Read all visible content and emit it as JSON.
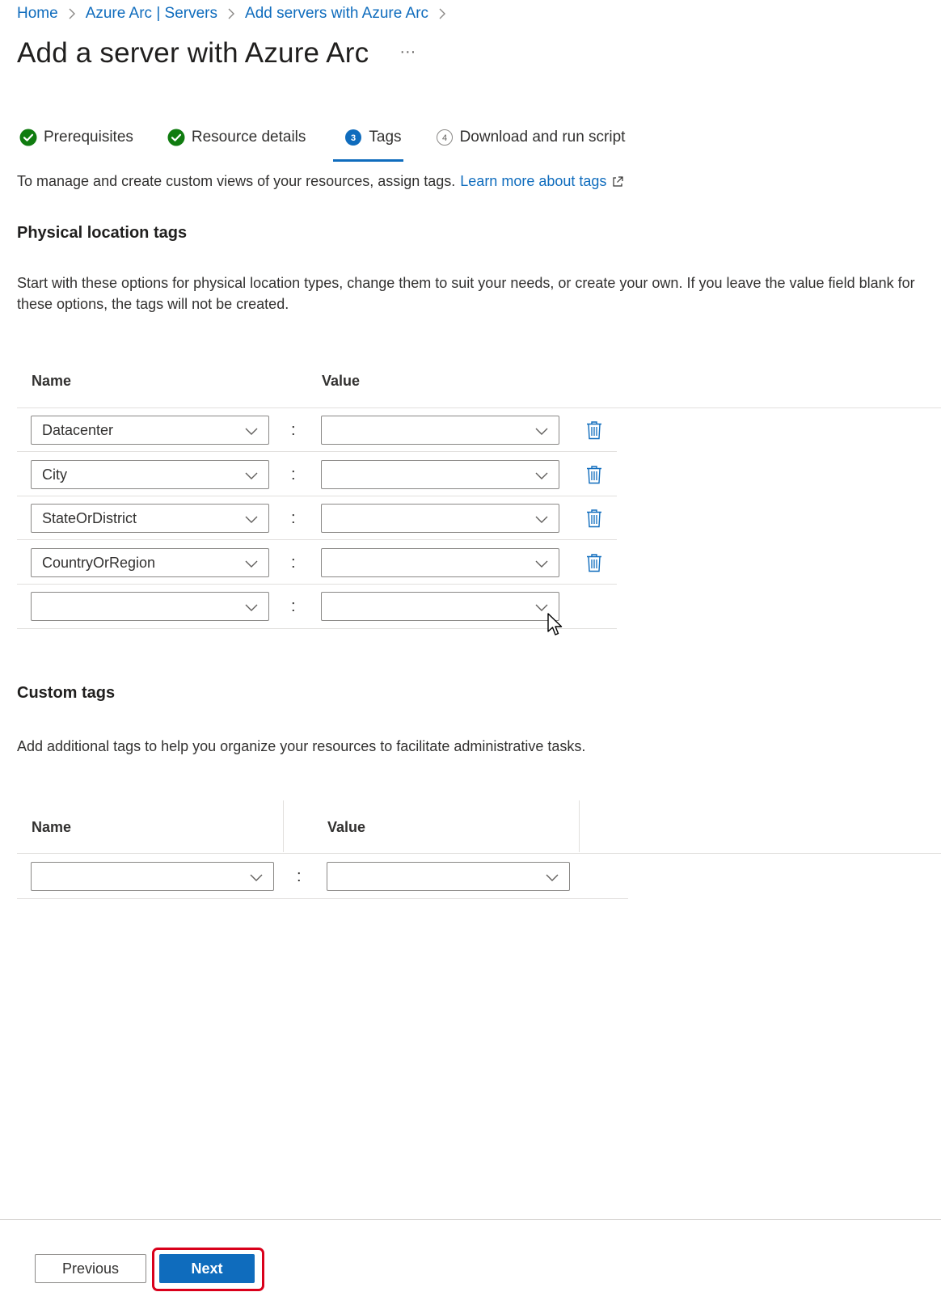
{
  "breadcrumb": [
    "Home",
    "Azure Arc | Servers",
    "Add servers with Azure Arc"
  ],
  "page_title": "Add a server with Azure Arc",
  "more_menu": "···",
  "steps": [
    {
      "label": "Prerequisites",
      "state": "complete"
    },
    {
      "label": "Resource details",
      "state": "complete"
    },
    {
      "label": "Tags",
      "state": "active",
      "number": "3"
    },
    {
      "label": "Download and run script",
      "state": "pending",
      "number": "4"
    }
  ],
  "intro": {
    "text": "To manage and create custom views of your resources, assign tags.",
    "link": "Learn more about tags"
  },
  "physical": {
    "heading": "Physical location tags",
    "description": "Start with these options for physical location types, change them to suit your needs, or create your own. If you leave the value field blank for these options, the tags will not be created.",
    "name_header": "Name",
    "value_header": "Value",
    "rows": [
      {
        "name": "Datacenter",
        "value": ""
      },
      {
        "name": "City",
        "value": ""
      },
      {
        "name": "StateOrDistrict",
        "value": ""
      },
      {
        "name": "CountryOrRegion",
        "value": ""
      },
      {
        "name": "",
        "value": ""
      }
    ]
  },
  "custom": {
    "heading": "Custom tags",
    "description": "Add additional tags to help you organize your resources to facilitate administrative tasks.",
    "name_header": "Name",
    "value_header": "Value",
    "rows": [
      {
        "name": "",
        "value": ""
      }
    ]
  },
  "separator": ":",
  "footer": {
    "previous_label": "Previous",
    "next_label": "Next"
  },
  "colors": {
    "accent": "#0f6cbd",
    "success": "#107c10",
    "highlight": "#d9001b"
  }
}
